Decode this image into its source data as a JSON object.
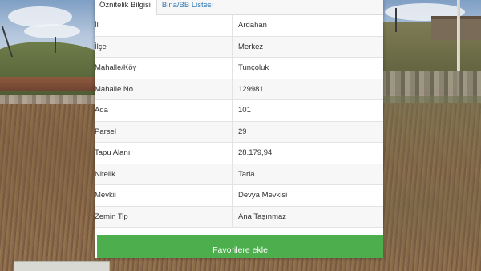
{
  "tabs": [
    {
      "label": "Öznitelik Bilgisi",
      "active": true
    },
    {
      "label": "Bina/BB Listesi",
      "active": false
    }
  ],
  "attributes": [
    {
      "label": "İl",
      "value": "Ardahan"
    },
    {
      "label": "İlçe",
      "value": "Merkez"
    },
    {
      "label": "Mahalle/Köy",
      "value": "Tunçoluk"
    },
    {
      "label": "Mahalle No",
      "value": "129981"
    },
    {
      "label": "Ada",
      "value": "101"
    },
    {
      "label": "Parsel",
      "value": "29"
    },
    {
      "label": "Tapu Alanı",
      "value": "28.179,94"
    },
    {
      "label": "Nitelik",
      "value": "Tarla"
    },
    {
      "label": "Mevkii",
      "value": "Devya Mevkisi"
    },
    {
      "label": "Zemin Tip",
      "value": "Ana Taşınmaz"
    }
  ],
  "favorite_button": {
    "label": "Favorilere ekle"
  },
  "colors": {
    "button_green": "#4cae4c",
    "tab_link_blue": "#337ab7",
    "row_stripe": "#f7f7f7"
  }
}
